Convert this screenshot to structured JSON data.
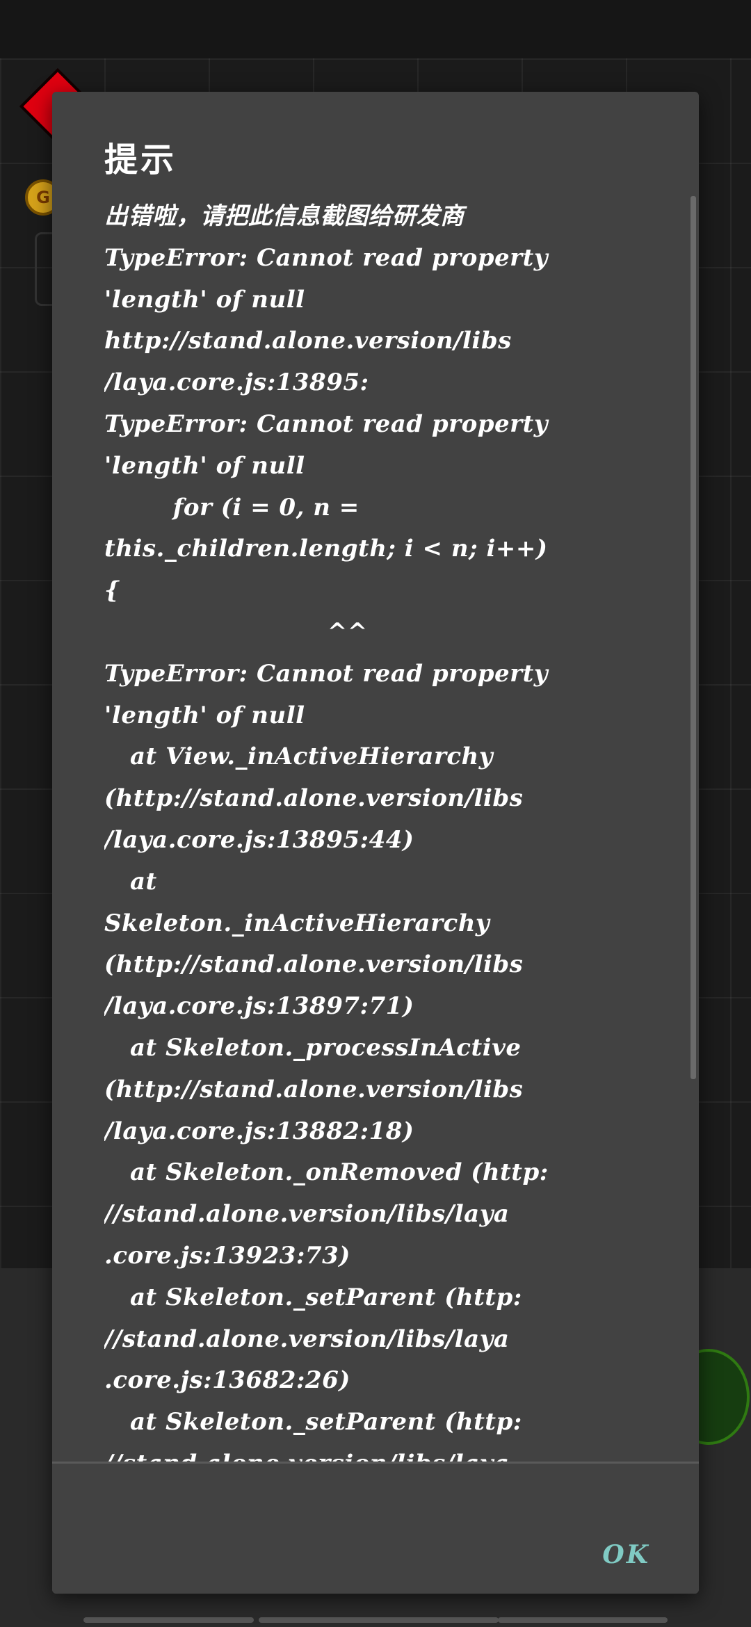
{
  "dialog": {
    "title": "提示",
    "message_lines": [
      "出错啦，请把此信息截图给研发商",
      "TypeError: Cannot read property",
      "'length' of null",
      "http://stand.alone.version/libs",
      "/laya.core.js:13895:",
      "TypeError: Cannot read property",
      "'length' of null",
      "        for (i = 0, n =",
      "this._children.length; i < n; i++)",
      "{",
      "                          ^^",
      "TypeError: Cannot read property",
      "'length' of null",
      "   at View._inActiveHierarchy",
      "(http://stand.alone.version/libs",
      "/laya.core.js:13895:44)",
      "   at",
      "Skeleton._inActiveHierarchy",
      "(http://stand.alone.version/libs",
      "/laya.core.js:13897:71)",
      "   at Skeleton._processInActive",
      "(http://stand.alone.version/libs",
      "/laya.core.js:13882:18)",
      "   at Skeleton._onRemoved (http:",
      "//stand.alone.version/libs/laya",
      ".core.js:13923:73)",
      "   at Skeleton._setParent (http:",
      "//stand.alone.version/libs/laya",
      ".core.js:13682:26)",
      "   at Skeleton._setParent (http:",
      "//stand.alone.version/libs/laya"
    ],
    "ok_label": "OK"
  },
  "background": {
    "coin_letter": "G"
  },
  "colors": {
    "dialog_bg": "#424242",
    "text": "#ffffff",
    "ok_accent": "#80cbc4",
    "red_diamond": "#e00010"
  }
}
